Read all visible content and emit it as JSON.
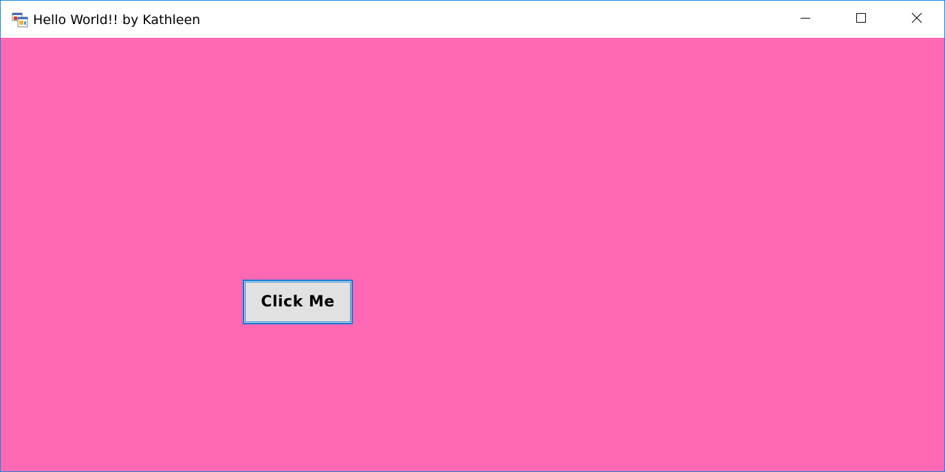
{
  "window": {
    "title": "Hello World!! by Kathleen",
    "app_icon": "winforms-app-icon",
    "controls": {
      "minimize_icon": "minimize-icon",
      "maximize_icon": "maximize-icon",
      "close_icon": "close-icon"
    }
  },
  "form": {
    "background_color": "#ff69b4",
    "button_label": "Click Me",
    "button_focus_color": "#0a78d7"
  }
}
